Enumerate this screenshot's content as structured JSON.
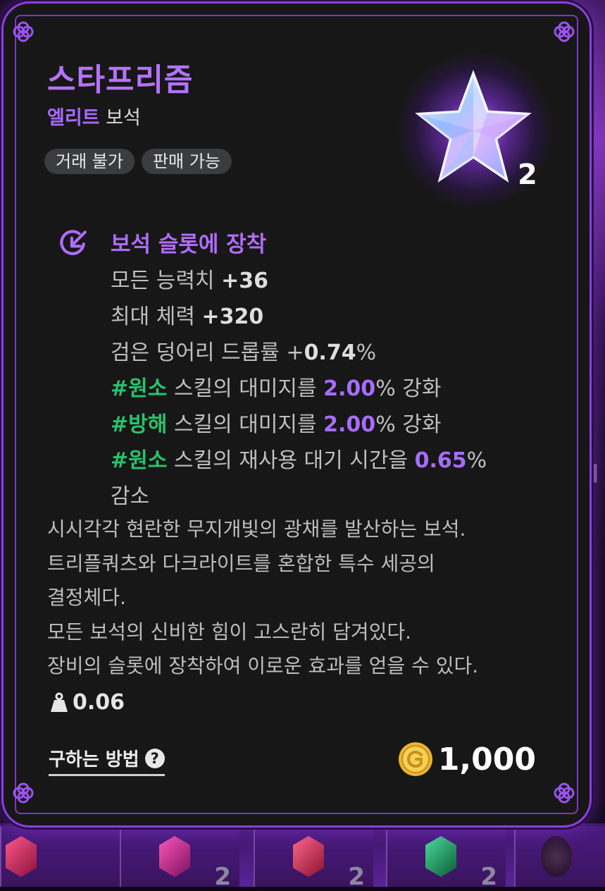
{
  "item": {
    "name": "스타프리즘",
    "grade": "엘리트",
    "kind": "보석",
    "tags": [
      "거래 불가",
      "판매 가능"
    ],
    "stack_count": "2",
    "icon": "star-gem-icon"
  },
  "effect": {
    "title": "보석 슬롯에 장착",
    "icon": "equip-slot-icon",
    "stats": [
      {
        "label": "모든 능력치 ",
        "value": "+36"
      },
      {
        "label": "최대 체력 ",
        "value": "+320"
      },
      {
        "label": "검은 덩어리 드롭률 ",
        "value_pre": "+",
        "value": "0.74",
        "suffix": "%"
      }
    ],
    "skill_lines": [
      {
        "tag": "#원소",
        "text": " 스킬의 대미지를 ",
        "value": "2.00",
        "suffix": "% 강화"
      },
      {
        "tag": "#방해",
        "text": " 스킬의 대미지를 ",
        "value": "2.00",
        "suffix": "% 강화"
      },
      {
        "tag": "#원소",
        "text": " 스킬의 재사용 대기 시간을 ",
        "value": "0.65",
        "suffix": "%"
      }
    ],
    "last_line": "감소"
  },
  "description": [
    "시시각각 현란한 무지개빛의 광채를 발산하는 보석.",
    "트리플쿼츠와 다크라이트를 혼합한 특수 세공의",
    "결정체다.",
    "모든 보석의 신비한 힘이 고스란히 담겨있다.",
    "장비의 슬롯에 장착하여 이로운 효과를 얻을 수 있다."
  ],
  "weight": "0.06",
  "how_to_get": "구하는 방법",
  "price": "1,000",
  "currency_icon": "gold-coin-icon",
  "inventory_counts": [
    "2",
    "2",
    "2"
  ],
  "colors": {
    "accent": "#b06bff",
    "frame": "#8c3fe0",
    "tag_green": "#27c26b",
    "background": "#171717"
  }
}
